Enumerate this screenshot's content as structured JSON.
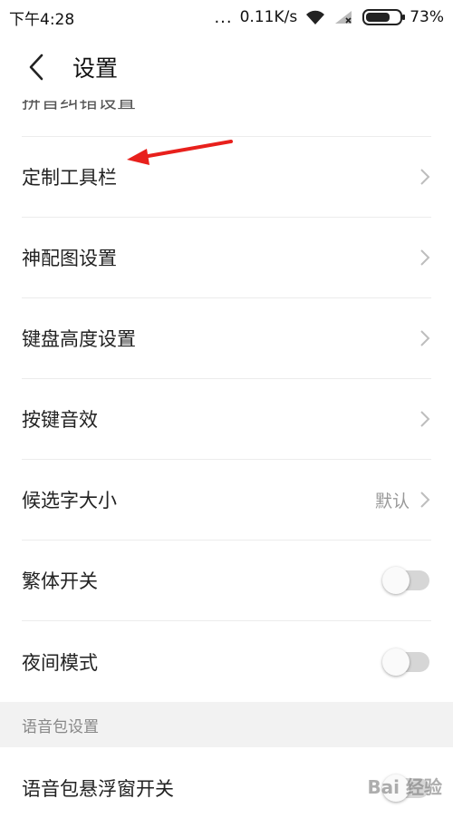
{
  "status_bar": {
    "time": "下午4:28",
    "dots": "...",
    "speed": "0.11K/s",
    "battery": "73%",
    "battery_level": 0.73
  },
  "header": {
    "title": "设置"
  },
  "list": {
    "partial_item": "拼音纠错设置",
    "items": [
      {
        "label": "定制工具栏"
      },
      {
        "label": "神配图设置"
      },
      {
        "label": "键盘高度设置"
      },
      {
        "label": "按键音效"
      },
      {
        "label": "候选字大小",
        "value": "默认"
      },
      {
        "label": "繁体开关",
        "toggle": false
      },
      {
        "label": "夜间模式",
        "toggle": false
      }
    ],
    "section_header": "语音包设置",
    "section_items": [
      {
        "label": "语音包悬浮窗开关",
        "toggle": false
      }
    ]
  },
  "overlay": {
    "arrow_color": "#e8201c",
    "watermark": "Bai 经验"
  },
  "colors": {
    "divider": "#ececec",
    "section_bg": "#f2f2f2"
  }
}
